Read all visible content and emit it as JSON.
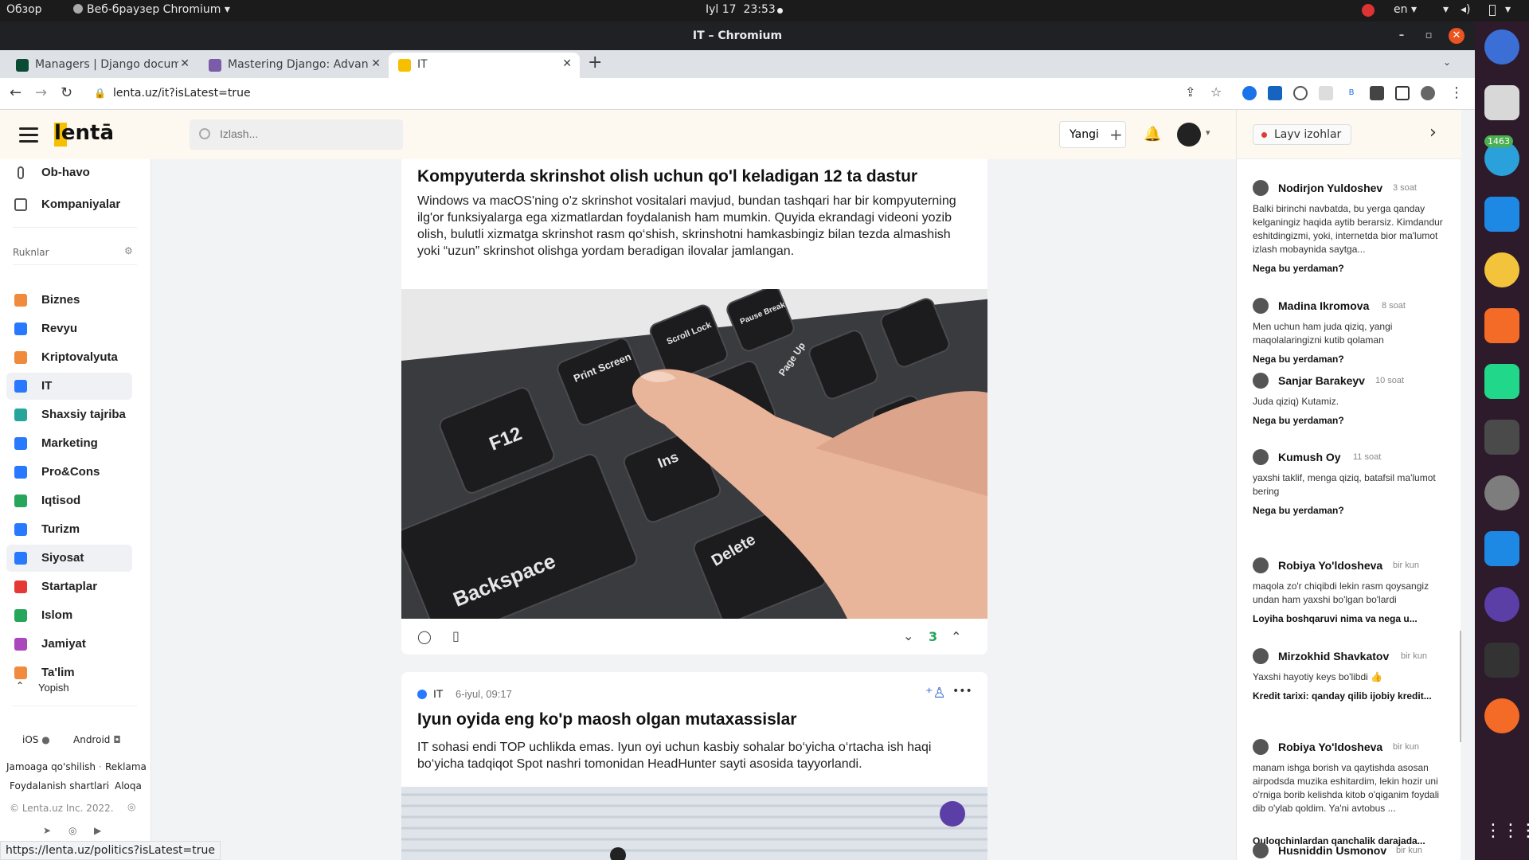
{
  "system": {
    "activities": "Обзор",
    "app_menu": "Веб-браузер Chromium",
    "date": "Iyl 17",
    "time": "23:53",
    "lang": "en"
  },
  "window": {
    "title": "IT – Chromium"
  },
  "tabs": [
    {
      "label": "Managers | Django docum",
      "favicon_color": "#0c4b33"
    },
    {
      "label": "Mastering Django: Advan",
      "favicon_color": "#7a5ca8"
    },
    {
      "label": "IT",
      "favicon_color": "#f6c000"
    }
  ],
  "address": {
    "url": "lenta.uz/it?isLatest=true"
  },
  "site": {
    "logo": "lentā",
    "search_placeholder": "Izlash...",
    "new_label": "Yangi",
    "new_plus": "+"
  },
  "leftnav": {
    "top_items": [
      {
        "label": "Ob-havo",
        "icon": "thermometer-icon",
        "color": "#555"
      },
      {
        "label": "Kompaniyalar",
        "icon": "building-icon",
        "color": "#555"
      }
    ],
    "section_label": "Ruknlar",
    "items": [
      {
        "label": "Biznes",
        "icon": "briefcase-icon",
        "color": "#f08a3c"
      },
      {
        "label": "Revyu",
        "icon": "review-icon",
        "color": "#2979ff"
      },
      {
        "label": "Kriptovalyuta",
        "icon": "crypto-icon",
        "color": "#f08a3c"
      },
      {
        "label": "IT",
        "icon": "globe-icon",
        "color": "#2979ff",
        "selected": true
      },
      {
        "label": "Shaxsiy tajriba",
        "icon": "person-icon",
        "color": "#26a69a"
      },
      {
        "label": "Marketing",
        "icon": "megaphone-icon",
        "color": "#2979ff"
      },
      {
        "label": "Pro&Cons",
        "icon": "scales-icon",
        "color": "#2979ff"
      },
      {
        "label": "Iqtisod",
        "icon": "money-icon",
        "color": "#26a65b"
      },
      {
        "label": "Turizm",
        "icon": "plane-icon",
        "color": "#2979ff"
      },
      {
        "label": "Siyosat",
        "icon": "flag-icon",
        "color": "#2979ff",
        "selected": true
      },
      {
        "label": "Startaplar",
        "icon": "gift-icon",
        "color": "#e53935"
      },
      {
        "label": "Islom",
        "icon": "islam-icon",
        "color": "#26a65b"
      },
      {
        "label": "Jamiyat",
        "icon": "community-icon",
        "color": "#ab47bc"
      },
      {
        "label": "Ta'lim",
        "icon": "book-icon",
        "color": "#f08a3c"
      }
    ],
    "collapse_label": "Yopish",
    "ios_label": "iOS",
    "android_label": "Android",
    "footer_links": [
      "Jamoaga qo'shilish",
      "Reklama",
      "Foydalanish shartlari",
      "Aloqa"
    ],
    "copyright": "© Lenta.uz Inc. 2022."
  },
  "feed": {
    "post1": {
      "title": "Kompyuterda skrinshot olish uchun qo'l keladigan 12 ta dastur",
      "description": "Windows va macOS'ning o'z skrinshot vositalari mavjud, bundan tashqari har bir kompyuterning ilg'or funksiyalarga ega xizmatlardan foydalanish ham mumkin. Quyida ekrandagi videoni yozib olish, bulutli xizmatga skrinshot rasm qo‘shish, skrinshotni hamkasbingiz bilan tezda almashish yoki “uzun” skrinshot olishga yordam beradigan ilovalar jamlangan.",
      "image_keys": [
        "F12",
        "Print Screen",
        "Scroll Lock",
        "Pause Break",
        "Page Up",
        "Backspace",
        "Ins",
        "Delete"
      ],
      "votes": "3"
    },
    "post2": {
      "category": "IT",
      "date": "6-iyul, 09:17",
      "title": "Iyun oyida eng ko'p maosh olgan mutaxassislar",
      "description": "IT sohasi endi TOP uchlikda emas. Iyun oyi uchun kasbiy sohalar bo‘yicha o‘rtacha ish haqi bo‘yicha tadqiqot Spot nashri tomonidan HeadHunter sayti asosida tayyorlandi.",
      "more": "•••"
    }
  },
  "live": {
    "title": "Layv izohlar",
    "comments": [
      {
        "name": "Nodirjon Yuldoshev",
        "time": "3 soat",
        "text": "Balki birinchi navbatda, bu yerga qanday kelganingiz haqida aytib berarsiz. Kimdandur eshitdingizmi, yoki, internetda bior ma'lumot izlash mobaynida saytga...",
        "article": "Nega bu yerdaman?"
      },
      {
        "name": "Madina Ikromova",
        "time": "8 soat",
        "text": "Men uchun ham juda qiziq, yangi maqolalaringizni kutib qolaman",
        "article": "Nega bu yerdaman?"
      },
      {
        "name": "Sanjar Barakeyv",
        "time": "10 soat",
        "text": "Juda qiziq) Kutamiz.",
        "article": "Nega bu yerdaman?"
      },
      {
        "name": "Kumush Oy",
        "time": "11 soat",
        "text": "yaxshi taklif, menga qiziq, batafsil ma'lumot bering",
        "article": "Nega bu yerdaman?"
      },
      {
        "name": "Robiya Yo'ldosheva",
        "time": "bir kun",
        "text": "maqola zo'r chiqibdi lekin rasm qoysangiz undan ham yaxshi bo'lgan bo'lardi",
        "article": "Loyiha boshqaruvi nima va nega u..."
      },
      {
        "name": "Mirzokhid Shavkatov",
        "time": "bir kun",
        "text": "Yaxshi hayotiy keys bo'libdi 👍",
        "article": "Kredit tarixi: qanday qilib ijobiy kredit..."
      },
      {
        "name": "Robiya Yo'ldosheva",
        "time": "bir kun",
        "text": "manam ishga borish va qaytishda asosan airpodsda muzika eshitardim, lekin hozir uni o'rniga borib kelishda kitob o'qiganim foydali dib o'ylab qoldim. Ya'ni avtobus ...",
        "article": "Quloqchinlardan qanchalik darajada..."
      },
      {
        "name": "Husniddin Usmonov",
        "time": "bir kun",
        "text": "",
        "article": ""
      }
    ]
  },
  "status_url": "https://lenta.uz/politics?isLatest=true",
  "dock": {
    "telegram_badge": "1463"
  }
}
